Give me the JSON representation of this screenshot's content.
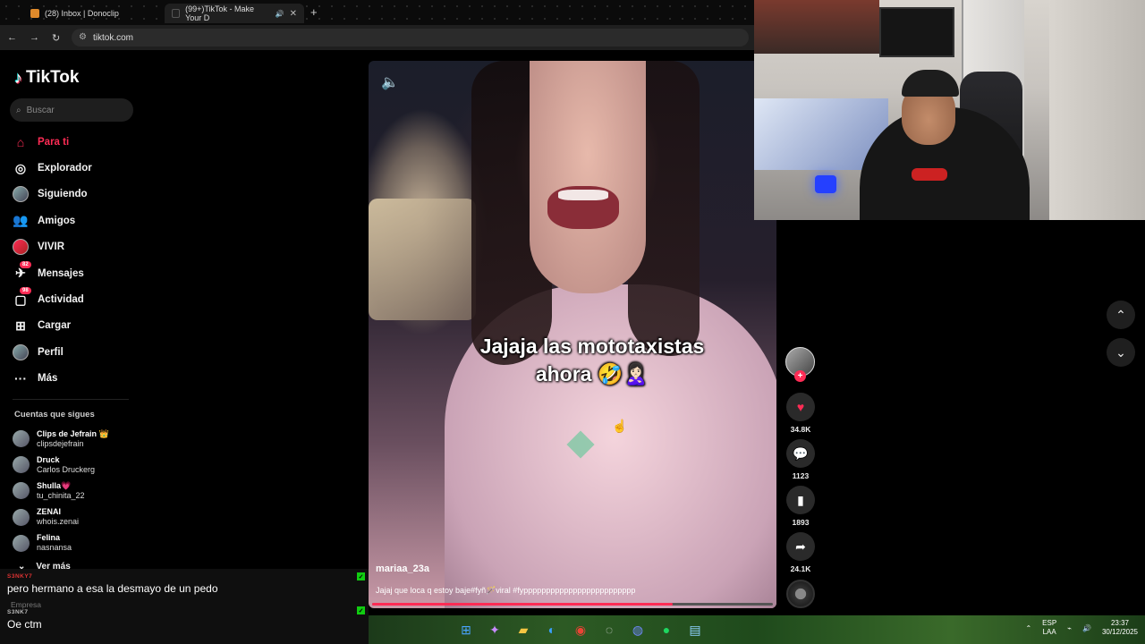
{
  "browser": {
    "tabs": [
      {
        "label": "(28) Inbox | Donoclip"
      },
      {
        "label": "(99+)TikTok - Make Your D"
      }
    ],
    "url": "tiktok.com"
  },
  "sidebar": {
    "brand": "TikTok",
    "search_placeholder": "Buscar",
    "nav": [
      {
        "label": "Para ti",
        "icon": "home-icon"
      },
      {
        "label": "Explorador",
        "icon": "compass-icon"
      },
      {
        "label": "Siguiendo",
        "icon": "following-avatar"
      },
      {
        "label": "Amigos",
        "icon": "friends-icon"
      },
      {
        "label": "VIVIR",
        "icon": "live-avatar"
      },
      {
        "label": "Mensajes",
        "icon": "messages-icon",
        "badge": "82"
      },
      {
        "label": "Actividad",
        "icon": "activity-icon",
        "badge": "98"
      },
      {
        "label": "Cargar",
        "icon": "upload-icon"
      },
      {
        "label": "Perfil",
        "icon": "profile-avatar"
      },
      {
        "label": "Más",
        "icon": "more-icon"
      }
    ],
    "following_title": "Cuentas que sigues",
    "accounts": [
      {
        "name": "Clips de Jefrain 👑",
        "handle": "clipsdejefrain"
      },
      {
        "name": "Druck",
        "handle": "Carlos Druckerg"
      },
      {
        "name": "Shulla💗",
        "handle": "tu_chinita_22"
      },
      {
        "name": "ZENAI",
        "handle": "whois.zenai"
      },
      {
        "name": "Felina",
        "handle": "nasnansa"
      }
    ],
    "see_more": "Ver más"
  },
  "chat": {
    "messages": [
      {
        "user": "S3NKY7",
        "text": "pero hermano a esa la desmayo de un pedo"
      },
      {
        "user": "S3NK7",
        "text": "Oe ctm"
      }
    ],
    "sub_label": "Empresa"
  },
  "video": {
    "caption_line1": "Jajaja las mototaxistas",
    "caption_line2": "ahora 🤣🙎🏻‍♀️",
    "username": "mariaa_23a",
    "description": "Jajaj que loca q estoy baje#fyñ🪄viral #fyppppppppppppppppppppppppp",
    "progress": 0.75
  },
  "actions": {
    "likes": "34.8K",
    "comments": "1123",
    "saves": "1893",
    "shares": "24.1K"
  },
  "taskbar": {
    "lang_top": "ESP",
    "lang_bottom": "LAA",
    "time": "23:37",
    "date": "30/12/2025"
  },
  "colors": {
    "accent": "#fe2c55",
    "bg": "#000000"
  }
}
